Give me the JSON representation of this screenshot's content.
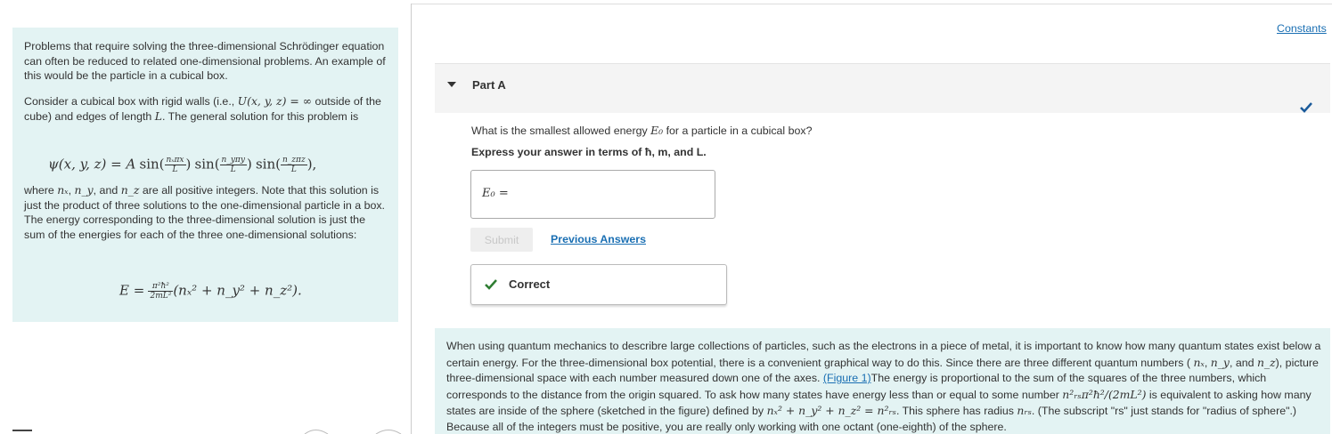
{
  "left": {
    "intro": "Problems that require solving the three-dimensional Schrödinger equation can often be reduced to related one-dimensional problems. An example of this would be the particle in a cubical box.",
    "cube_before": "Consider a cubical box with rigid walls (i.e.,",
    "cube_potential": "U(x, y, z) = ∞",
    "cube_mid": "outside of the cube) and edges of length",
    "cube_length": "L",
    "cube_after": ". The general solution for this problem is",
    "psi_lhs": "ψ(x, y, z) = A",
    "sin_label": "sin",
    "frac_x_num": "nₓπx",
    "frac_y_num": "n_yπy",
    "frac_z_num": "n_zπz",
    "frac_den": "L",
    "where_before": "where",
    "nx": "nₓ",
    "ny": "n_y",
    "nz": "n_z",
    "where_after": "are all positive integers. Note that this solution is just the product of three solutions to the one-dimensional particle in a box. The energy corresponding to the three-dimensional solution is just the sum of the energies for each of the three one-dimensional solutions:",
    "energy_lhs": "E =",
    "energy_num": "π²ħ²",
    "energy_den": "2mL²",
    "energy_rhs": "(nₓ² + n_y² + n_z²)."
  },
  "constants_link": "Constants",
  "part": {
    "title": "Part A",
    "question_before": "What is the smallest allowed energy",
    "question_symbol": "E₀",
    "question_after": "for a particle in a cubical box?",
    "instruction": "Express your answer in terms of ħ, m, and L.",
    "answer_label": "E₀ =",
    "answer_value": "",
    "submit_label": "Submit",
    "previous_answers_label": "Previous Answers",
    "feedback_label": "Correct"
  },
  "info": {
    "text_1": "When using quantum mechanics to describre large collections of particles, such as the electrons in a piece of metal, it is important to know how many quantum states exist below a certain energy. For the three-dimensional box potential, there is a convenient graphical way to do this. Since there are three different quantum numbers (",
    "text_2": ",",
    "text_3": ", and",
    "text_4": "), picture three-dimensional space with each number measured down one of the axes.",
    "figure_link": "(Figure 1)",
    "text_5": "The energy is proportional to the sum of the squares of the three numbers, which corresponds to the distance from the origin squared. To ask how many states have energy less than or equal to some number",
    "energy_expr": "n²ᵣₛπ²ħ²/(2mL²)",
    "text_6": "is equivalent to asking how many states are inside of the sphere (sketched in the figure) defined by",
    "sphere_expr": "nₓ² + n_y² + n_z² = n²ᵣₛ",
    "text_7": ". This sphere has radius",
    "radius_symbol": "nᵣₛ",
    "text_8": ". (The subscript \"rs\" just stands for \"radius of sphere\".) Because all of the integers must be positive, you are really only working with one octant (one-eighth) of the sphere."
  },
  "colors": {
    "panel_bg": "#e3f3f3",
    "link": "#1a6fb3",
    "check": "#2e7d32"
  },
  "icons": {
    "toggle": "caret-down-icon",
    "check": "checkmark-icon"
  }
}
